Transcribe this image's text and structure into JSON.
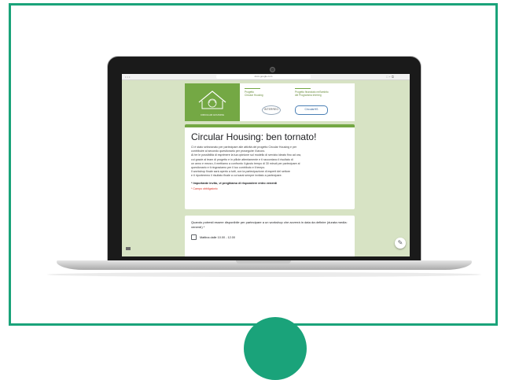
{
  "browser": {
    "url": "docs.google.com",
    "left_controls": "• • •",
    "right_controls": "□ + ⧉"
  },
  "header": {
    "logo_caption": "CIRCULAR HOUSING",
    "partner1": "Progetto\nCircular Housing",
    "partner2": "Progetto finanziato nell'ambito\ndel Programma Interreg",
    "badge1": "INTERREG",
    "badge2": "CircularHS"
  },
  "form": {
    "title": "Circular Housing: ben tornato!",
    "description": [
      "Ci è stato selezionato per partecipare alle attività del progetto Circular Housing e per",
      "contribuire al secondo questionario per proseguire il lavoro.",
      "Ai tre le possibilità di esprimere la tua opinione sul modello di servizio ideato fino ad ora,",
      "cui grazie al team di progetto e in pillole attentamente e ti raccontano il risultato di",
      "un anno e mezzo, il mettiamo a confronto il giusto tempo di 30 minuti per partecipare al",
      "questionario e ti ringraziamo per il tuo contributo e il tempo.",
      "Il workshop finale sarà aperto a tutti, con la partecipazione di esperti del settore",
      "e ti riporteremo il risultato finale a cui sarai sempre invitato a partecipare."
    ],
    "important_note": "* Importante invito, vi preghiamo di rispondere entro venerdì",
    "required_note": "* Campo obbligatorio"
  },
  "question": {
    "text": "Quando potresti essere disponibile per partecipare a un workshop che avverrà in data da definire (durata media: venerdì) *",
    "option1": "Mattina dalle 10.00 - 12.00"
  },
  "colors": {
    "frame_green": "#1aa37a",
    "form_accent": "#74a844",
    "screen_bg": "#d7e3c4"
  },
  "icons": {
    "edit": "pencil-icon"
  }
}
